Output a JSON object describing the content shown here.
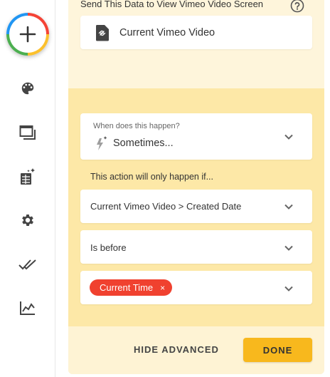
{
  "sidebar": {
    "add_button": {
      "icon": "plus-icon"
    },
    "items": [
      {
        "icon": "palette-icon"
      },
      {
        "icon": "screens-icon"
      },
      {
        "icon": "table-sparkle-icon"
      },
      {
        "icon": "gear-icon"
      },
      {
        "icon": "double-check-icon"
      },
      {
        "icon": "analytics-icon"
      }
    ]
  },
  "data_section": {
    "label": "Send This Data to View Vimeo Video Screen",
    "help_icon": "help-icon",
    "source": {
      "icon": "vimeo-file-icon",
      "value": "Current Vimeo Video"
    }
  },
  "trigger": {
    "label": "When does this happen?",
    "value": "Sometimes...",
    "icon": "lightning-sparkle-icon"
  },
  "condition": {
    "hint": "This action will only happen if...",
    "field": "Current Vimeo Video > Created Date",
    "operator": "Is before",
    "value_chip": "Current Time",
    "chip_remove": "×"
  },
  "footer": {
    "hide_advanced": "HIDE ADVANCED",
    "done": "DONE"
  },
  "colors": {
    "accent": "#f8b81d",
    "chip": "#f0412f",
    "panel_mid": "#fde8a7"
  }
}
